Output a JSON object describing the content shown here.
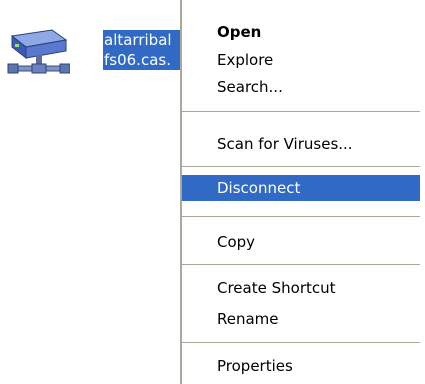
{
  "desktop_icon": {
    "icon": "network-drive-icon",
    "label_line1": "altarribal",
    "label_line2": "fs06.cas."
  },
  "context_menu": {
    "items": [
      {
        "label": "Open",
        "bold": true
      },
      {
        "label": "Explore"
      },
      {
        "label": "Search..."
      },
      {
        "label": "Scan for Viruses..."
      },
      {
        "label": "Disconnect",
        "selected": true
      },
      {
        "label": "Copy"
      },
      {
        "label": "Create Shortcut"
      },
      {
        "label": "Rename"
      },
      {
        "label": "Properties"
      }
    ]
  },
  "colors": {
    "selection": "#316ac5",
    "separator": "#aca899"
  }
}
